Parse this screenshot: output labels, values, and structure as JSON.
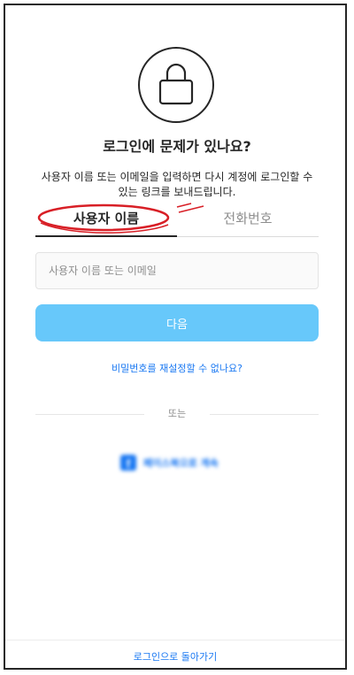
{
  "header": {
    "icon": "lock-icon",
    "title": "로그인에 문제가 있나요?",
    "description": "사용자 이름 또는 이메일을 입력하면 다시 계정에 로그인할 수 있는 링크를 보내드립니다."
  },
  "tabs": [
    {
      "label": "사용자 이름",
      "active": true
    },
    {
      "label": "전화번호",
      "active": false
    }
  ],
  "form": {
    "input_value": "",
    "input_placeholder": "사용자 이름 또는 이메일",
    "next_label": "다음"
  },
  "links": {
    "reset_password": "비밀번호를 재설정할 수 없나요?",
    "or_label": "또는",
    "facebook_label": "페이스북으로 계속",
    "back_to_login": "로그인으로 돌아가기"
  },
  "colors": {
    "button_bg": "#67c8fa",
    "link": "#1877f2",
    "annotation": "#d81f26"
  }
}
